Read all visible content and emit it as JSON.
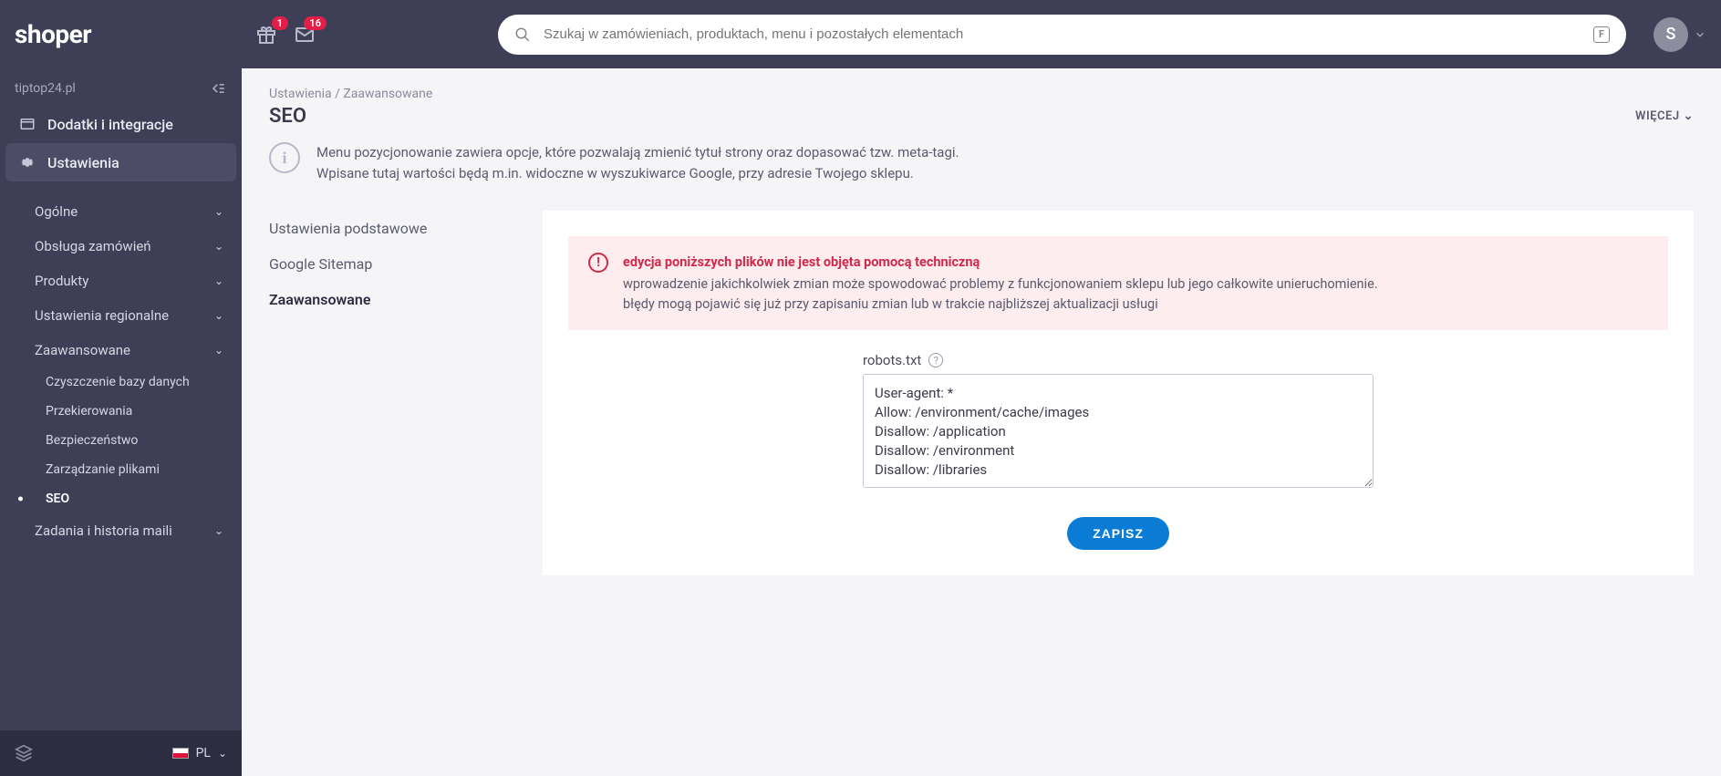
{
  "header": {
    "logo": "shoper",
    "gift_badge": "1",
    "mail_badge": "16",
    "search_placeholder": "Szukaj w zamówieniach, produktach, menu i pozostałych elementach",
    "search_shortcut": "F",
    "avatar_initial": "S"
  },
  "sidebar": {
    "site": "tiptop24.pl",
    "items": [
      {
        "label": "Dodatki i integracje"
      },
      {
        "label": "Ustawienia",
        "active": true
      }
    ],
    "subs": [
      {
        "label": "Ogólne"
      },
      {
        "label": "Obsługa zamówień"
      },
      {
        "label": "Produkty"
      },
      {
        "label": "Ustawienia regionalne"
      },
      {
        "label": "Zaawansowane",
        "expanded": true
      },
      {
        "label": "Zadania i historia maili"
      }
    ],
    "subsubs": [
      {
        "label": "Czyszczenie bazy danych"
      },
      {
        "label": "Przekierowania"
      },
      {
        "label": "Bezpieczeństwo"
      },
      {
        "label": "Zarządzanie plikami"
      },
      {
        "label": "SEO",
        "active": true
      }
    ],
    "lang": "PL"
  },
  "main": {
    "breadcrumb": {
      "a": "Ustawienia",
      "sep": "/",
      "b": "Zaawansowane"
    },
    "title": "SEO",
    "more_label": "WIĘCEJ",
    "info_line1": "Menu pozycjonowanie zawiera opcje, które pozwalają zmienić tytuł strony oraz dopasować tzw. meta-tagi.",
    "info_line2": "Wpisane tutaj wartości będą m.in. widoczne w wyszukiwarce Google, przy adresie Twojego sklepu.",
    "tabs": [
      {
        "label": "Ustawienia podstawowe"
      },
      {
        "label": "Google Sitemap"
      },
      {
        "label": "Zaawansowane",
        "active": true
      }
    ],
    "alert": {
      "title": "edycja poniższych plików nie jest objęta pomocą techniczną",
      "line1": "wprowadzenie jakichkolwiek zmian może spowodować problemy z funkcjonowaniem sklepu lub jego całkowite unieruchomienie.",
      "line2": "błędy mogą pojawić się już przy zapisaniu zmian lub w trakcie najbliższej aktualizacji usługi"
    },
    "field": {
      "label": "robots.txt",
      "value": "User-agent: *\nAllow: /environment/cache/images\nDisallow: /application\nDisallow: /environment\nDisallow: /libraries"
    },
    "save_label": "ZAPISZ"
  }
}
